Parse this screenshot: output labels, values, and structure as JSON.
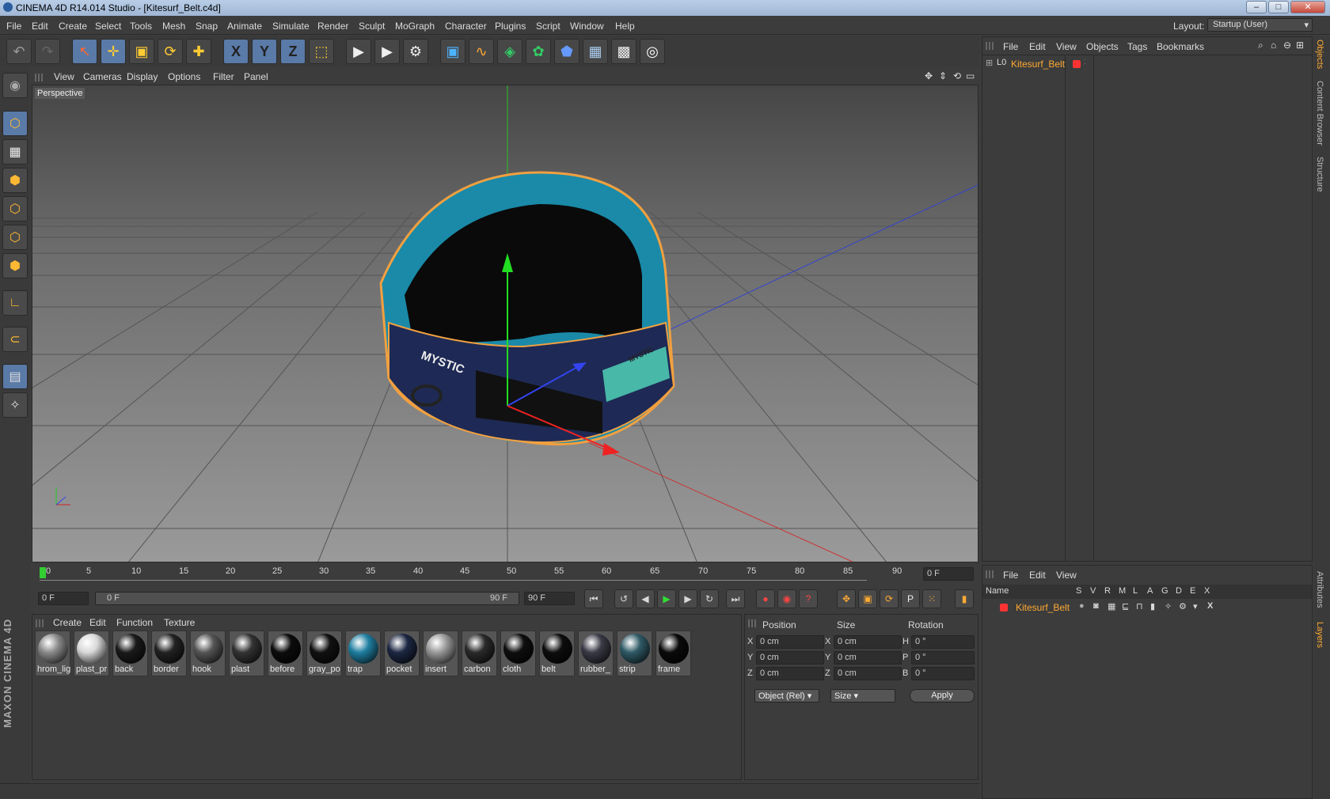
{
  "window": {
    "title": "CINEMA 4D R14.014 Studio - [Kitesurf_Belt.c4d]",
    "controls": [
      "–",
      "□",
      "✕"
    ]
  },
  "menu": [
    "File",
    "Edit",
    "Create",
    "Select",
    "Tools",
    "Mesh",
    "Snap",
    "Animate",
    "Simulate",
    "Render",
    "Sculpt",
    "MoGraph",
    "Character",
    "Plugins",
    "Script",
    "Window",
    "Help"
  ],
  "layout": {
    "label": "Layout:",
    "value": "Startup (User)"
  },
  "toolbar": {
    "undo": "↶",
    "redo": "↷",
    "select": "↖",
    "move": "✛",
    "scale": "▣",
    "rotate": "⟳",
    "live": "✚",
    "x": "X",
    "y": "Y",
    "z": "Z",
    "coord": "⬚",
    "render_view": "▶",
    "render_pv": "▶",
    "render_settings": "⚙",
    "cube": "▣",
    "spline": "∿",
    "nurbs": "◈",
    "array": "✿",
    "deformer": "⬟",
    "scene": "▦",
    "camera": "▩",
    "light": "◎"
  },
  "viewport": {
    "menu": [
      "View",
      "Cameras",
      "Display",
      "Options",
      "Filter",
      "Panel"
    ],
    "label": "Perspective",
    "brand_small": "MYSTIC",
    "brand_large": "MYSTIC"
  },
  "timeline": {
    "ticks": [
      "0",
      "5",
      "10",
      "15",
      "20",
      "25",
      "30",
      "35",
      "40",
      "45",
      "50",
      "55",
      "60",
      "65",
      "70",
      "75",
      "80",
      "85",
      "90"
    ],
    "end_field": "0 F"
  },
  "transport": {
    "start": "0 F",
    "range_start": "0 F",
    "range_end": "90 F",
    "end": "90 F"
  },
  "materials": {
    "menu": [
      "Create",
      "Edit",
      "Function",
      "Texture"
    ],
    "items": [
      {
        "label": "hrom_lig",
        "color": "#8a8a8a"
      },
      {
        "label": "plast_pr",
        "color": "#d8d8d8"
      },
      {
        "label": "back",
        "color": "#1a1a1a"
      },
      {
        "label": "border",
        "color": "#222222"
      },
      {
        "label": "hook",
        "color": "#555555"
      },
      {
        "label": "plast",
        "color": "#333333"
      },
      {
        "label": "before",
        "color": "#0c0c0c"
      },
      {
        "label": "gray_po",
        "color": "#111111"
      },
      {
        "label": "trap",
        "color": "#1f7ea0"
      },
      {
        "label": "pocket",
        "color": "#1c2742"
      },
      {
        "label": "insert",
        "color": "#9a9a9a"
      },
      {
        "label": "carbon",
        "color": "#2a2a2a"
      },
      {
        "label": "cloth",
        "color": "#0e0e0e"
      },
      {
        "label": "belt",
        "color": "#0d0d0d"
      },
      {
        "label": "rubber_",
        "color": "#3a3a46"
      },
      {
        "label": "strip",
        "color": "#2f5a66"
      },
      {
        "label": "frame",
        "color": "#0a0a0a"
      }
    ]
  },
  "coords": {
    "headers": [
      "Position",
      "Size",
      "Rotation"
    ],
    "rows": [
      {
        "a": "X",
        "pos": "0 cm",
        "b": "X",
        "size": "0 cm",
        "c": "H",
        "rot": "0 °"
      },
      {
        "a": "Y",
        "pos": "0 cm",
        "b": "Y",
        "size": "0 cm",
        "c": "P",
        "rot": "0 °"
      },
      {
        "a": "Z",
        "pos": "0 cm",
        "b": "Z",
        "size": "0 cm",
        "c": "B",
        "rot": "0 °"
      }
    ],
    "mode": "Object (Rel)",
    "size_mode": "Size",
    "apply": "Apply"
  },
  "objects": {
    "menu": [
      "File",
      "Edit",
      "View",
      "Objects",
      "Tags",
      "Bookmarks"
    ],
    "item": "Kitesurf_Belt",
    "item_color": "#ff3333"
  },
  "layers": {
    "menu": [
      "File",
      "Edit",
      "View"
    ],
    "columns": [
      "Name",
      "S",
      "V",
      "R",
      "M",
      "L",
      "A",
      "G",
      "D",
      "E",
      "X"
    ],
    "item": "Kitesurf_Belt"
  },
  "righttabs": [
    "Objects",
    "Content Browser",
    "Structure",
    "Attributes",
    "Layers"
  ],
  "logo": "MAXON CINEMA 4D"
}
